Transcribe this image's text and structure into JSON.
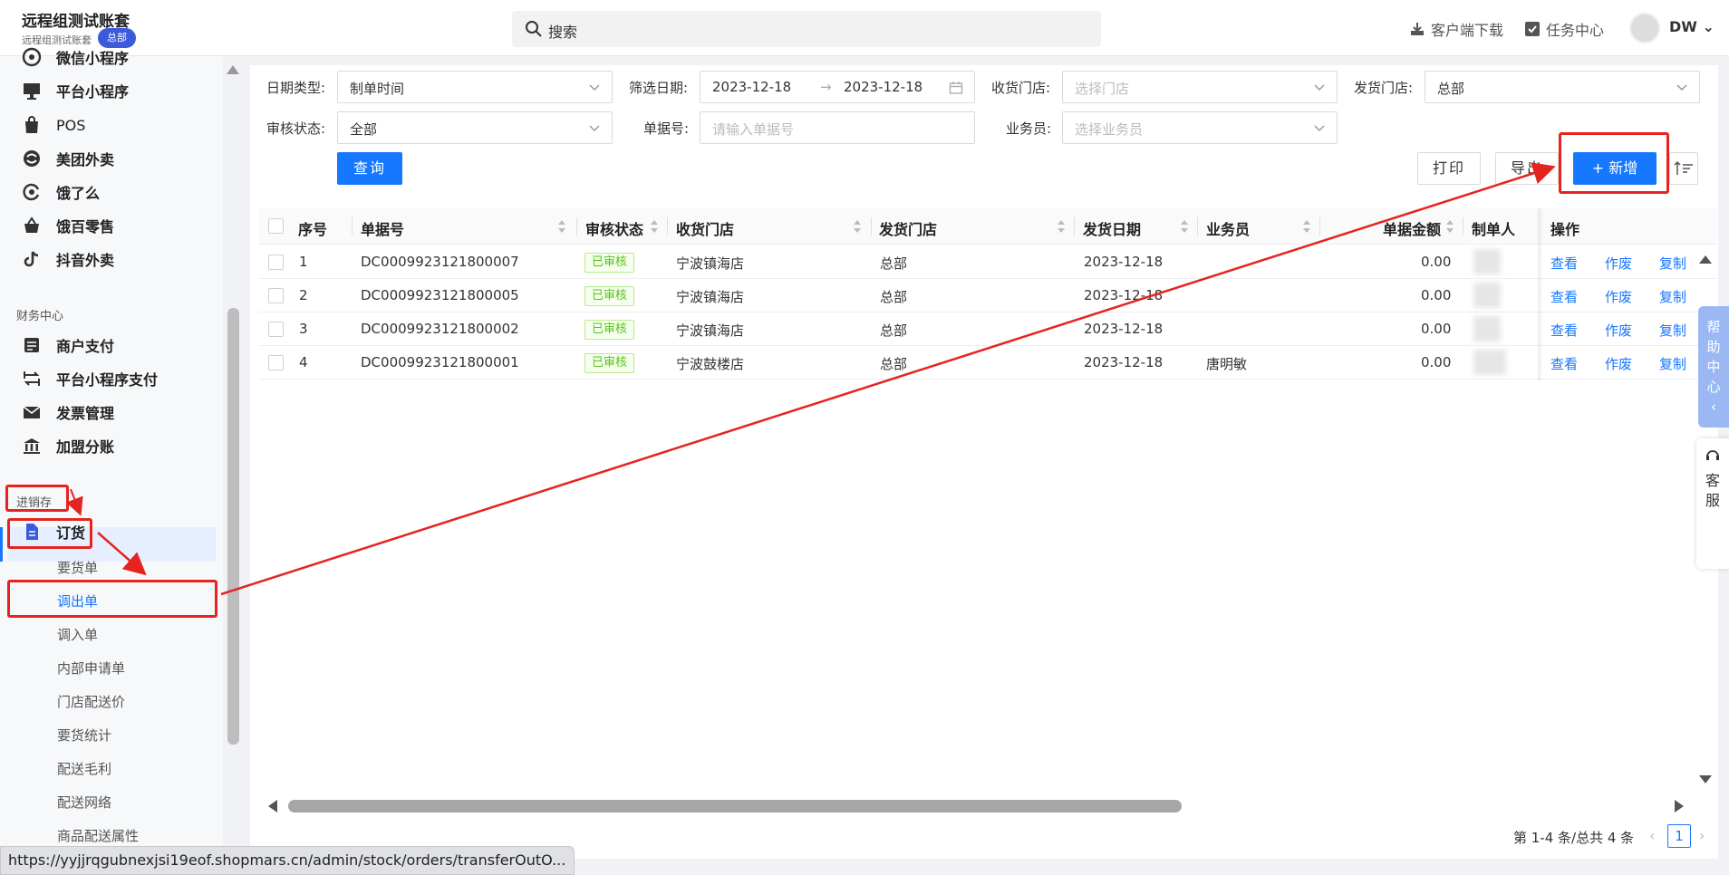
{
  "header": {
    "org_name": "远程组测试账套",
    "org_sub": "远程组测试账套",
    "org_badge": "总部",
    "search_placeholder": "搜索",
    "download_label": "客户端下载",
    "task_label": "任务中心",
    "user_name": "DW"
  },
  "sidebar": {
    "items_top": [
      {
        "label": "微信小程序"
      },
      {
        "label": "平台小程序"
      },
      {
        "label": "POS"
      },
      {
        "label": "美团外卖"
      },
      {
        "label": "饿了么"
      },
      {
        "label": "饿百零售"
      },
      {
        "label": "抖音外卖"
      }
    ],
    "section_finance": "财务中心",
    "items_finance": [
      {
        "label": "商户支付"
      },
      {
        "label": "平台小程序支付"
      },
      {
        "label": "发票管理"
      },
      {
        "label": "加盟分账"
      }
    ],
    "section_stock": "进销存",
    "group_order": "订货",
    "sub_items": [
      {
        "label": "要货单"
      },
      {
        "label": "调出单"
      },
      {
        "label": "调入单"
      },
      {
        "label": "内部申请单"
      },
      {
        "label": "门店配送价"
      },
      {
        "label": "要货统计"
      },
      {
        "label": "配送毛利"
      },
      {
        "label": "配送网络"
      },
      {
        "label": "商品配送属性"
      }
    ]
  },
  "filters": {
    "date_type_label": "日期类型:",
    "date_type_value": "制单时间",
    "filter_date_label": "筛选日期:",
    "date_start": "2023-12-18",
    "date_sep": "→",
    "date_end": "2023-12-18",
    "recv_store_label": "收货门店:",
    "recv_store_placeholder": "选择门店",
    "send_store_label": "发货门店:",
    "send_store_value": "总部",
    "audit_label": "审核状态:",
    "audit_value": "全部",
    "doc_no_label": "单据号:",
    "doc_no_placeholder": "请输入单据号",
    "salesman_label": "业务员:",
    "salesman_placeholder": "选择业务员"
  },
  "actions": {
    "query": "查询",
    "print": "打印",
    "export": "导出",
    "add": "+ 新增"
  },
  "table": {
    "columns": [
      "序号",
      "单据号",
      "审核状态",
      "收货门店",
      "发货门店",
      "发货日期",
      "业务员",
      "单据金额",
      "制单人",
      "操作"
    ],
    "rows": [
      {
        "no": "1",
        "doc": "DC0009923121800007",
        "status": "已审核",
        "recv": "宁波镇海店",
        "send": "总部",
        "date": "2023-12-18",
        "salesman": "",
        "amount": "0.00"
      },
      {
        "no": "2",
        "doc": "DC0009923121800005",
        "status": "已审核",
        "recv": "宁波镇海店",
        "send": "总部",
        "date": "2023-12-18",
        "salesman": "",
        "amount": "0.00"
      },
      {
        "no": "3",
        "doc": "DC0009923121800002",
        "status": "已审核",
        "recv": "宁波镇海店",
        "send": "总部",
        "date": "2023-12-18",
        "salesman": "",
        "amount": "0.00"
      },
      {
        "no": "4",
        "doc": "DC0009923121800001",
        "status": "已审核",
        "recv": "宁波鼓楼店",
        "send": "总部",
        "date": "2023-12-18",
        "salesman": "唐明敏",
        "amount": "0.00"
      }
    ],
    "ops": [
      "查看",
      "作废",
      "复制"
    ]
  },
  "pager": {
    "summary": "第 1-4 条/总共 4 条",
    "current": "1"
  },
  "float": {
    "help": "帮助中心",
    "service": "客服"
  },
  "status_url": "https://yyjjrqgubnexjsi19eof.shopmars.cn/admin/stock/orders/transferOutO..."
}
